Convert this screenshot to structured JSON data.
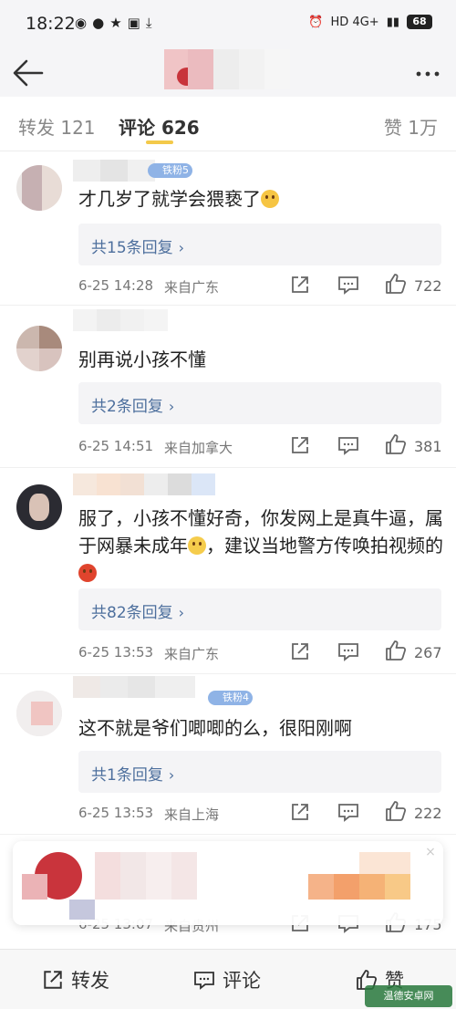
{
  "status_bar": {
    "time": "18:22",
    "left_icons": [
      "weibo-icon",
      "chat-icon",
      "star-icon",
      "gallery-icon",
      "download-icon"
    ],
    "network": "HD 4G+",
    "battery": "68"
  },
  "tabs": {
    "repost_label": "转发 121",
    "comment_label": "评论 626",
    "like_label": "赞 1万"
  },
  "comments": [
    {
      "badge": "铁粉5",
      "text": "才几岁了就学会猥亵了",
      "emoji": "smile",
      "replies_label": "共15条回复",
      "time": "6-25 14:28",
      "location": "来自广东",
      "likes": "722"
    },
    {
      "badge": "",
      "text": "别再说小孩不懂",
      "replies_label": "共2条回复",
      "time": "6-25 14:51",
      "location": "来自加拿大",
      "likes": "381"
    },
    {
      "badge": "",
      "text_part1": "服了，小孩不懂好奇，你发网上是真牛逼，属于网暴未成年",
      "text_part2": "，建议当地警方传唤拍视频的",
      "replies_label": "共82条回复",
      "time": "6-25 13:53",
      "location": "来自广东",
      "likes": "267"
    },
    {
      "badge": "铁粉4",
      "text": "这不就是爷们唧唧的么，很阳刚啊",
      "replies_label": "共1条回复",
      "time": "6-25 13:53",
      "location": "来自上海",
      "likes": "222"
    },
    {
      "time": "6-25 13:07",
      "location": "来自贵州",
      "likes": "175"
    }
  ],
  "bottom_bar": {
    "repost_label": "转发",
    "comment_label": "评论",
    "like_label": "赞"
  },
  "watermark": "温德安卓网",
  "colors": {
    "accent_yellow": "#f3c94a",
    "link_blue": "#4d6f9d",
    "badge_blue": "#8fb3e6"
  }
}
